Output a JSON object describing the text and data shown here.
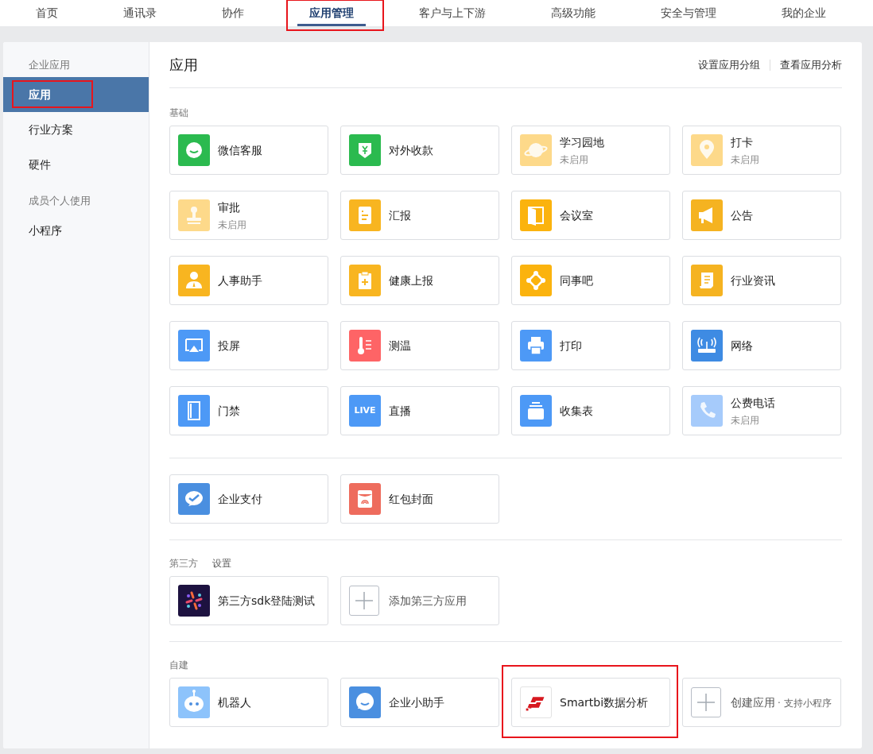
{
  "top_nav": [
    {
      "label": "首页",
      "selected": false,
      "highlighted": false
    },
    {
      "label": "通讯录",
      "selected": false,
      "highlighted": false
    },
    {
      "label": "协作",
      "selected": false,
      "highlighted": false
    },
    {
      "label": "应用管理",
      "selected": true,
      "highlighted": true
    },
    {
      "label": "客户与上下游",
      "selected": false,
      "highlighted": false
    },
    {
      "label": "高级功能",
      "selected": false,
      "highlighted": false
    },
    {
      "label": "安全与管理",
      "selected": false,
      "highlighted": false
    },
    {
      "label": "我的企业",
      "selected": false,
      "highlighted": false
    }
  ],
  "sidebar": {
    "items": [
      {
        "kind": "heading",
        "label": "企业应用"
      },
      {
        "kind": "item",
        "label": "应用",
        "selected": true,
        "highlighted": true
      },
      {
        "kind": "item",
        "label": "行业方案",
        "selected": false,
        "highlighted": false
      },
      {
        "kind": "item",
        "label": "硬件",
        "selected": false,
        "highlighted": false
      },
      {
        "kind": "heading",
        "label": "成员个人使用"
      },
      {
        "kind": "item",
        "label": "小程序",
        "selected": false,
        "highlighted": false
      }
    ]
  },
  "main": {
    "title": "应用",
    "actions": [
      "设置应用分组",
      "查看应用分析"
    ],
    "sections": [
      {
        "title": "基础",
        "apps": [
          {
            "kind": "app",
            "name": "微信客服",
            "color": "#2bba4f",
            "disabled": false
          },
          {
            "kind": "app",
            "name": "对外收款",
            "color": "#2bba4f",
            "disabled": false
          },
          {
            "kind": "app",
            "name": "学习园地",
            "subtitle": "未启用",
            "color": "#fdd98a",
            "disabled": true
          },
          {
            "kind": "app",
            "name": "打卡",
            "subtitle": "未启用",
            "color": "#fdd98a",
            "disabled": true
          },
          {
            "kind": "app",
            "name": "审批",
            "subtitle": "未启用",
            "color": "#fdd98a",
            "disabled": true
          },
          {
            "kind": "app",
            "name": "汇报",
            "color": "#f8b520",
            "disabled": false
          },
          {
            "kind": "app",
            "name": "会议室",
            "color": "#fbb30e",
            "disabled": false
          },
          {
            "kind": "app",
            "name": "公告",
            "color": "#f5b321",
            "disabled": false
          },
          {
            "kind": "app",
            "name": "人事助手",
            "color": "#f8b520",
            "disabled": false
          },
          {
            "kind": "app",
            "name": "健康上报",
            "color": "#f8b520",
            "disabled": false
          },
          {
            "kind": "app",
            "name": "同事吧",
            "color": "#fbb30e",
            "disabled": false
          },
          {
            "kind": "app",
            "name": "行业资讯",
            "color": "#f5b321",
            "disabled": false
          },
          {
            "kind": "app",
            "name": "投屏",
            "color": "#4d99f6",
            "disabled": false
          },
          {
            "kind": "app",
            "name": "测温",
            "color": "#fe6466",
            "disabled": false
          },
          {
            "kind": "app",
            "name": "打印",
            "color": "#4d99f6",
            "disabled": false
          },
          {
            "kind": "app",
            "name": "网络",
            "color": "#3e8be3",
            "disabled": false
          },
          {
            "kind": "app",
            "name": "门禁",
            "color": "#4d99f6",
            "disabled": false
          },
          {
            "kind": "app",
            "name": "直播",
            "icon_text": "LIVE",
            "color": "#4d99f6",
            "disabled": false
          },
          {
            "kind": "app",
            "name": "收集表",
            "color": "#4d99f6",
            "disabled": false
          },
          {
            "kind": "app",
            "name": "公费电话",
            "subtitle": "未启用",
            "color": "#a6cbfb",
            "disabled": true
          }
        ]
      },
      {
        "apps": [
          {
            "kind": "app",
            "name": "企业支付",
            "color": "#4a8fe0",
            "disabled": false
          },
          {
            "kind": "app",
            "name": "红包封面",
            "color": "#ee6c5d",
            "disabled": false
          }
        ]
      },
      {
        "title": "第三方",
        "link": "设置",
        "apps": [
          {
            "kind": "app",
            "name": "第三方sdk登陆测试",
            "color": "#1d1240",
            "disabled": false
          },
          {
            "kind": "add",
            "name": "添加第三方应用"
          }
        ]
      },
      {
        "title": "自建",
        "apps": [
          {
            "kind": "app",
            "name": "机器人",
            "color": "#8dc3fb",
            "disabled": false
          },
          {
            "kind": "app",
            "name": "企业小助手",
            "color": "#4a8fe0",
            "disabled": false
          },
          {
            "kind": "app",
            "name": "Smartbi数据分析",
            "color": "#ffffff",
            "disabled": false,
            "highlighted": true
          },
          {
            "kind": "add",
            "name": "创建应用",
            "subtitle": "· 支持小程序"
          }
        ]
      }
    ]
  }
}
